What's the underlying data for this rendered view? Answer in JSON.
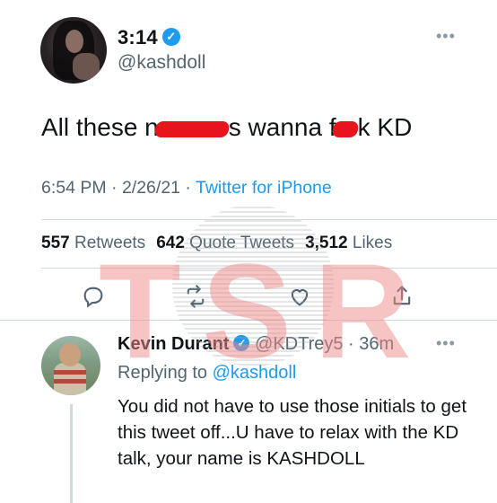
{
  "main_tweet": {
    "display_name": "3:14",
    "handle": "@kashdoll",
    "text_part1": "All these n",
    "text_part2": "s wanna f",
    "text_part3": "k KD",
    "timestamp": "6:54 PM · 2/26/21 · ",
    "source": "Twitter for iPhone",
    "retweets_count": "557",
    "retweets_label": "Retweets",
    "quotes_count": "642",
    "quotes_label": "Quote Tweets",
    "likes_count": "3,512",
    "likes_label": "Likes"
  },
  "reply": {
    "display_name": "Kevin Durant",
    "handle_time": "@KDTrey5 · 36m",
    "replying_prefix": "Replying to ",
    "replying_to": "@kashdoll",
    "text": "You did not have to use those initials to get this tweet off...U have to relax with the KD talk, your name is KASHDOLL"
  },
  "watermark": {
    "letters": "TSR"
  },
  "icons": {
    "verified": "verified-badge-icon",
    "more": "more-options-icon",
    "reply": "reply-icon",
    "retweet": "retweet-icon",
    "like": "heart-icon",
    "share": "share-icon"
  },
  "colors": {
    "link": "#1d9bf0",
    "redaction": "#e8141c",
    "watermark": "#f08a8a",
    "secondary_text": "#536471"
  }
}
